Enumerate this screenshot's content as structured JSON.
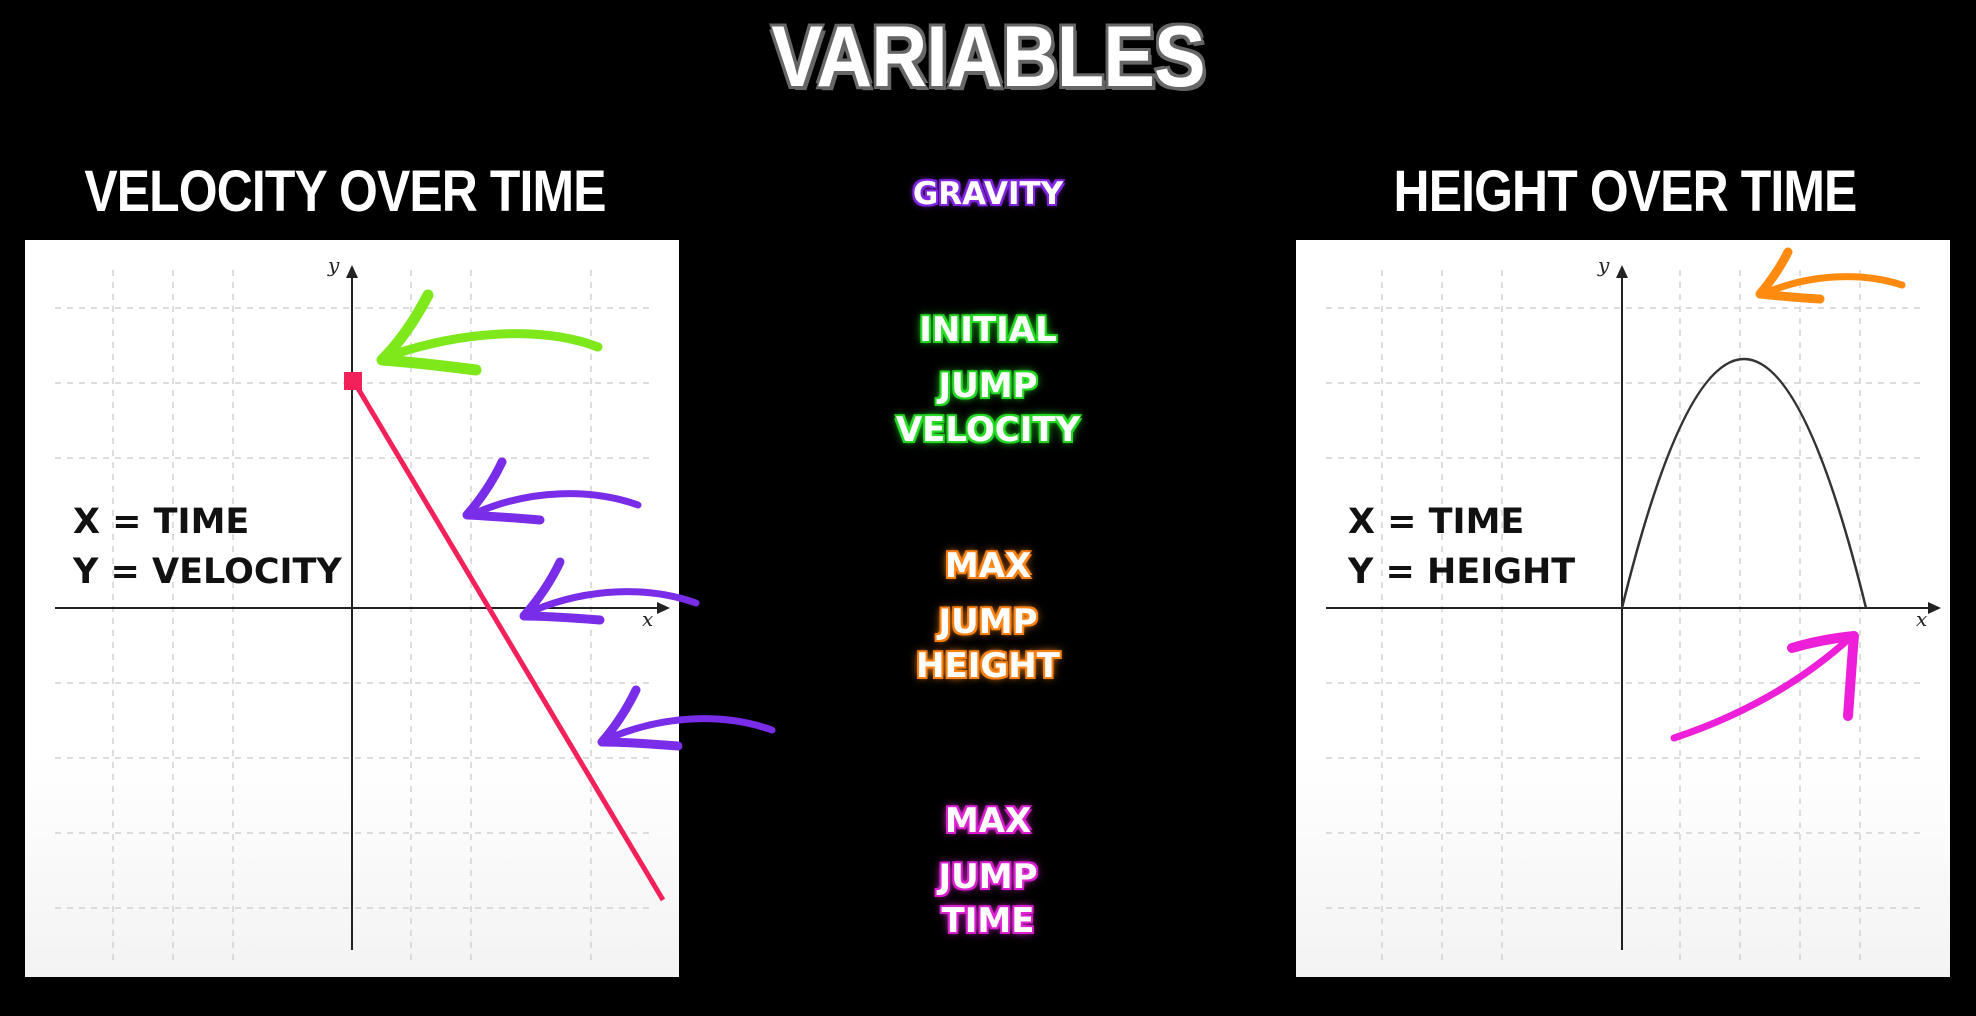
{
  "title": "VARIABLES",
  "left_panel": {
    "heading": "VELOCITY OVER TIME",
    "axis_x": "x",
    "axis_y": "y",
    "label_line1": "X = TIME",
    "label_line2": "Y = VELOCITY"
  },
  "right_panel": {
    "heading": "HEIGHT OVER TIME",
    "axis_x": "x",
    "axis_y": "y",
    "label_line1": "X = TIME",
    "label_line2": "Y = HEIGHT"
  },
  "variables": {
    "gravity": "GRAVITY",
    "initial_velocity": [
      "INITIAL",
      "JUMP",
      "VELOCITY"
    ],
    "max_height": [
      "MAX",
      "JUMP",
      "HEIGHT"
    ],
    "max_time": [
      "MAX",
      "JUMP",
      "TIME"
    ]
  },
  "colors": {
    "gravity": "#8a2be2",
    "initial_velocity": "#2ee82e",
    "max_height": "#ff8a1c",
    "max_time": "#e22ad8",
    "velocity_line": "#f2215a"
  }
}
